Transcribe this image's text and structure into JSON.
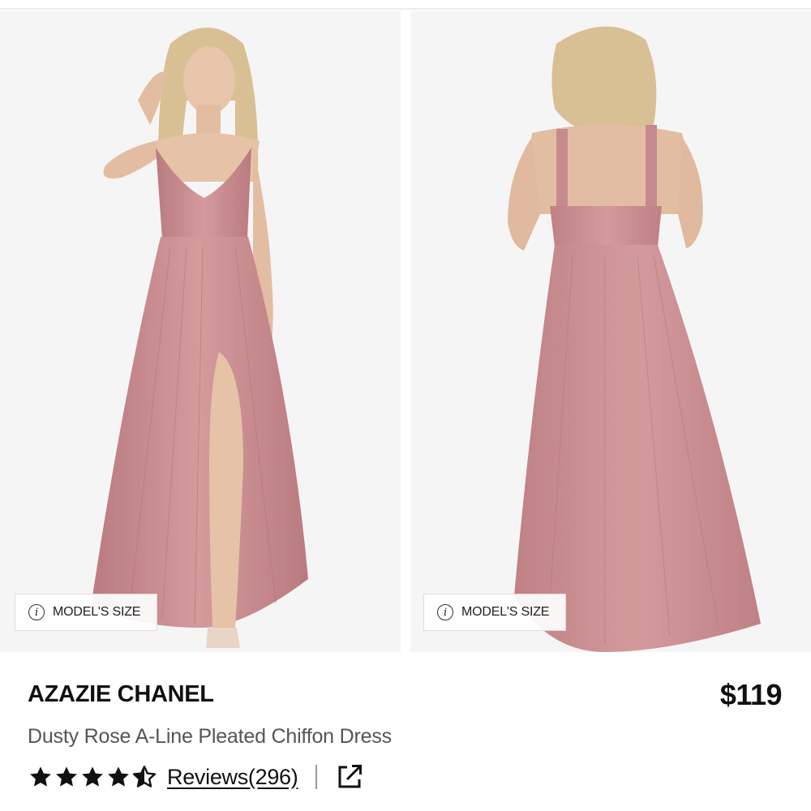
{
  "gallery": {
    "front_image": {
      "alt": "dusty-rose-dress-front",
      "badge_label": "MODEL'S SIZE"
    },
    "back_image": {
      "alt": "dusty-rose-dress-back",
      "badge_label": "MODEL'S SIZE"
    }
  },
  "product": {
    "brand": "AZAZIE CHANEL",
    "name": "Dusty Rose A-Line Pleated Chiffon Dress",
    "price": "$119",
    "rating": 4.5,
    "rating_max": 5,
    "reviews_label": "Reviews(296)"
  },
  "icons": {
    "info": "info-icon",
    "star": "star-icon",
    "share": "external-link-icon"
  },
  "colors": {
    "dress": "#c88c8f",
    "text_primary": "#111111",
    "text_secondary": "#555555"
  }
}
